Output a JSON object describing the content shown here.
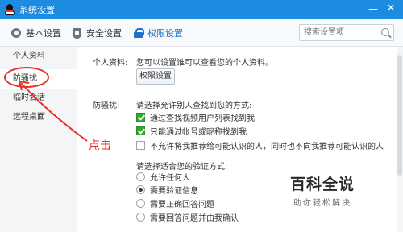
{
  "window": {
    "title": "系统设置",
    "minimize_glyph": "—",
    "close_glyph": "✕"
  },
  "tabs": [
    {
      "label": "基本设置",
      "icon": "gear-icon"
    },
    {
      "label": "安全设置",
      "icon": "shield-icon"
    },
    {
      "label": "权限设置",
      "icon": "lock-icon",
      "active": true
    }
  ],
  "search": {
    "placeholder": "搜索设置项"
  },
  "sidebar": {
    "items": [
      {
        "label": "个人资料"
      },
      {
        "label": "防骚扰",
        "active": true
      },
      {
        "label": "临时会话"
      },
      {
        "label": "远程桌面"
      }
    ]
  },
  "annotation": {
    "click_label": "点击"
  },
  "profile": {
    "label": "个人资料:",
    "description": "您可以设置谁可以查看您的个人资料。",
    "button": "权限设置"
  },
  "disturb": {
    "label": "防骚扰:",
    "find_desc": "请选择允许别人查找到您的方式:",
    "find_options": [
      {
        "label": "通过查找视频用户列表找到我",
        "checked": true
      },
      {
        "label": "只能通过帐号或昵称找到我",
        "checked": true
      },
      {
        "label": "不允许将我推荐给可能认识的人，同时也不向我推荐可能认识的人",
        "checked": false
      }
    ],
    "verify_desc": "请选择适合您的验证方式:",
    "verify_options": [
      {
        "label": "允许任何人",
        "selected": false
      },
      {
        "label": "需要验证信息",
        "selected": true
      },
      {
        "label": "需要正确回答问题",
        "selected": false
      },
      {
        "label": "需要回答问题并由我确认",
        "selected": false
      }
    ]
  },
  "watermark": {
    "title": "百科全说",
    "subtitle": "助你轻松解决"
  },
  "colors": {
    "titlebar": "#1d8bdf",
    "accent": "#1d71c4",
    "annotation": "#e8302a",
    "check": "#35a82e"
  }
}
